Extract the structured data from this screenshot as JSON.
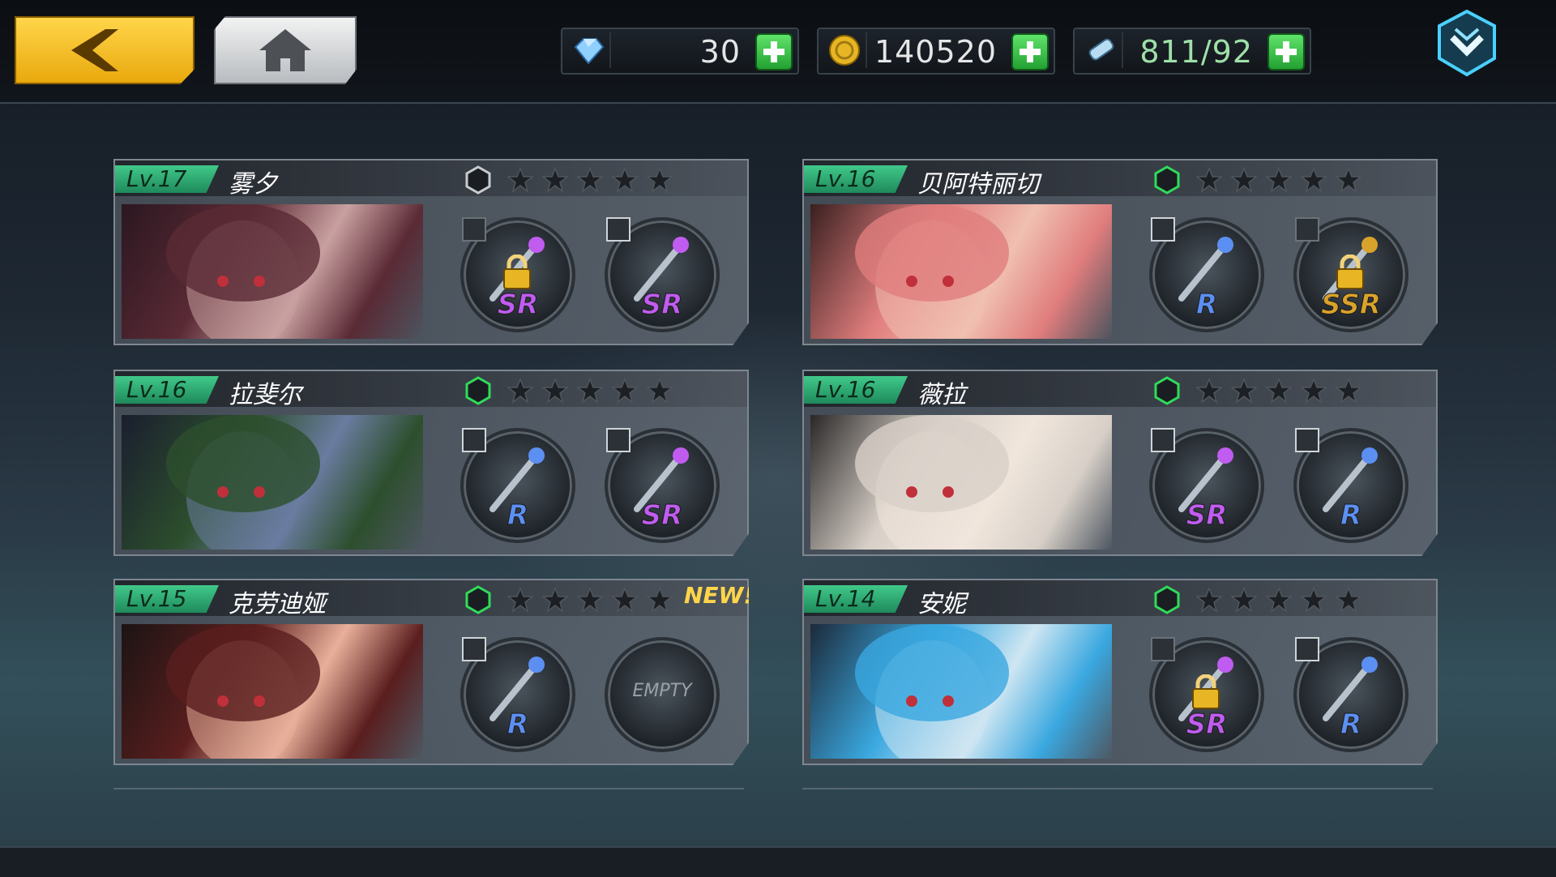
{
  "topbar": {
    "back_icon": "back-arrow-icon",
    "home_icon": "home-icon",
    "resources": [
      {
        "icon": "gem-icon",
        "value": "30"
      },
      {
        "icon": "gold-coin-icon",
        "value": "140520"
      },
      {
        "icon": "stamina-potion-icon",
        "value": "811/92"
      }
    ],
    "menu_icon": "chevron-down-menu-icon"
  },
  "colors": {
    "level_badge": "#2fb377",
    "gold_button": "#f2c12e",
    "plus_button": "#3cc94b",
    "rarity_R": "#5c8ff2",
    "rarity_SR": "#c05cf0",
    "rarity_SSR": "#d9a22a"
  },
  "characters": [
    {
      "level": "Lv.17",
      "name": "雾夕",
      "star_rank": 0,
      "hex_active": false,
      "new_label": "",
      "portrait_colors": [
        "#5a2a35",
        "#2b1720",
        "#c9a0a0"
      ],
      "weapons": [
        {
          "rarity": "SR",
          "locked": true,
          "empty_label": "",
          "edit_dim": true,
          "icon": "fan-weapon-icon"
        },
        {
          "rarity": "SR",
          "locked": false,
          "empty_label": "",
          "edit_dim": false,
          "icon": "staff-weapon-icon"
        }
      ]
    },
    {
      "level": "Lv.16",
      "name": "贝阿特丽切",
      "star_rank": 0,
      "hex_active": true,
      "new_label": "",
      "portrait_colors": [
        "#e07d7d",
        "#3a2020",
        "#f0c0b0"
      ],
      "weapons": [
        {
          "rarity": "R",
          "locked": false,
          "empty_label": "",
          "edit_dim": false,
          "icon": "sword-weapon-icon"
        },
        {
          "rarity": "SSR",
          "locked": true,
          "empty_label": "",
          "edit_dim": true,
          "icon": "greatsword-weapon-icon"
        }
      ]
    },
    {
      "level": "Lv.16",
      "name": "拉斐尔",
      "star_rank": 0,
      "hex_active": true,
      "new_label": "",
      "portrait_colors": [
        "#2d4f2d",
        "#1a1e2e",
        "#6a7ca0"
      ],
      "weapons": [
        {
          "rarity": "R",
          "locked": false,
          "empty_label": "",
          "edit_dim": false,
          "icon": "dual-wands-weapon-icon"
        },
        {
          "rarity": "SR",
          "locked": false,
          "empty_label": "",
          "edit_dim": false,
          "icon": "chakram-weapon-icon"
        }
      ]
    },
    {
      "level": "Lv.16",
      "name": "薇拉",
      "star_rank": 0,
      "hex_active": true,
      "new_label": "",
      "portrait_colors": [
        "#d8d0c8",
        "#2a2828",
        "#f0e6dc"
      ],
      "weapons": [
        {
          "rarity": "SR",
          "locked": false,
          "empty_label": "",
          "edit_dim": false,
          "icon": "death-coffin-weapon-icon"
        },
        {
          "rarity": "R",
          "locked": false,
          "empty_label": "",
          "edit_dim": false,
          "icon": "cannon-weapon-icon"
        }
      ]
    },
    {
      "level": "Lv.15",
      "name": "克劳迪娅",
      "star_rank": 0,
      "hex_active": true,
      "new_label": "NEW!",
      "portrait_colors": [
        "#5a1e1e",
        "#1c1414",
        "#e8b09a"
      ],
      "weapons": [
        {
          "rarity": "R",
          "locked": false,
          "empty_label": "",
          "edit_dim": false,
          "icon": "rose-scepter-weapon-icon"
        },
        {
          "rarity": "",
          "locked": false,
          "empty_label": "EMPTY",
          "edit_dim": false,
          "icon": "empty-slot-icon"
        }
      ]
    },
    {
      "level": "Lv.14",
      "name": "安妮",
      "star_rank": 0,
      "hex_active": true,
      "new_label": "",
      "portrait_colors": [
        "#3aa8e0",
        "#1c2a3a",
        "#cfe6f2"
      ],
      "weapons": [
        {
          "rarity": "SR",
          "locked": true,
          "empty_label": "",
          "edit_dim": true,
          "icon": "camera-weapon-icon"
        },
        {
          "rarity": "R",
          "locked": false,
          "empty_label": "",
          "edit_dim": false,
          "icon": "key-staff-weapon-icon"
        }
      ]
    }
  ]
}
